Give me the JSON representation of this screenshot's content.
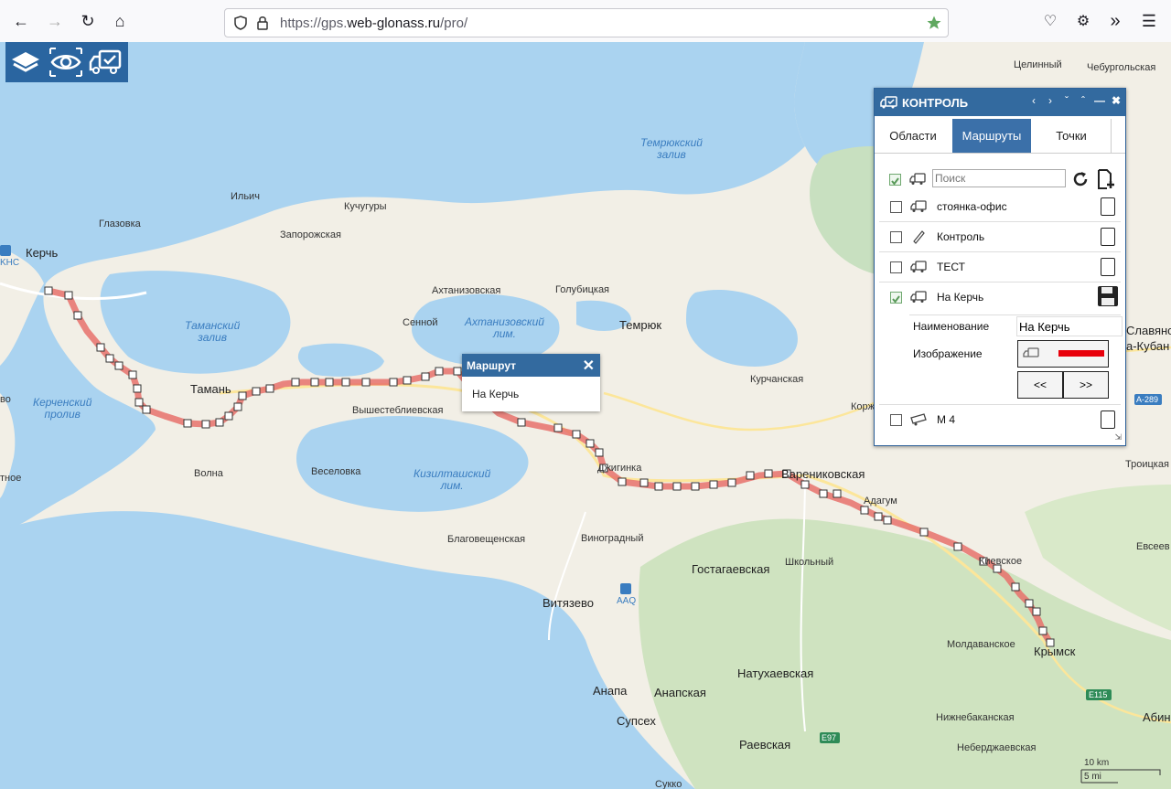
{
  "browser": {
    "url_prefix": "https://gps.",
    "url_domain": "web-glonass.ru",
    "url_path": "/pro/"
  },
  "map": {
    "labels": {
      "kerch": "Керчь",
      "khc": "KHC",
      "glazovka": "Глазовка",
      "ilich": "Ильич",
      "kuchuguri": "Кучугуры",
      "zaporozhskaya": "Запорожская",
      "taman": "Тамань",
      "volna": "Волна",
      "veselovka": "Веселовка",
      "vyshestebliyevskaya": "Вышестеблиевская",
      "akhtanizovskaya": "Ахтанизовская",
      "sennoy": "Сенной",
      "golubitskaya": "Голубицкая",
      "temryuk": "Темрюк",
      "kurchanskaya": "Курчанская",
      "blagoveshchenskaya": "Благовещенская",
      "vinogradniy": "Виноградный",
      "vityazevo": "Витязево",
      "aaq": "AAQ",
      "gostagaevskaya": "Гостагаевская",
      "shkolniy": "Школьный",
      "varenikovskaya": "Варениковская",
      "dzhiginka": "Джигинка",
      "adagum": "Адагум",
      "kievskoe": "Киевское",
      "krymsk": "Крымск",
      "moldavanskoe": "Молдаванское",
      "natukhaevskaya": "Натухаевская",
      "anapa": "Анапа",
      "anapskaya": "Анапская",
      "supseh": "Супсех",
      "raevskaya": "Раевская",
      "nizhnebakanskaya": "Нижнебаканская",
      "neberdzhaevskaya": "Неберджаевская",
      "tselinniy": "Целинный",
      "cheburgolskaya": "Чебургольская",
      "slavyansk": "Славянс",
      "kuban": "а-Кубан",
      "troitskaya": "Троицкая",
      "evseev": "Евсеев",
      "abin": "Абин",
      "korzh": "Корж",
      "sukko": "Сукко",
      "vo": "во",
      "tnoe": "тное",
      "temryuk_bay": "Темрюкский\nзалив",
      "taman_bay": "Таманский\nзалив",
      "kerch_strait": "Керченский\nпролив",
      "akhtanizovsky": "Ахтанизовский\nлим.",
      "kiziltashsky": "Кизилташский\nлим.",
      "road_a289": "А-289",
      "road_e115": "E115",
      "road_e97": "E97",
      "scale_km": "10 km",
      "scale_mi": "5 mi"
    },
    "colors": {
      "water": "#aad3f0",
      "land": "#f2efe6",
      "route": "#e8716b"
    }
  },
  "toolbar": {
    "icons": [
      "layers-icon",
      "eye-icon",
      "truck-check-icon"
    ]
  },
  "control_panel": {
    "title": "КОНТРОЛЬ",
    "tabs": [
      "Области",
      "Маршруты",
      "Точки"
    ],
    "active_tab": "Маршруты",
    "search_placeholder": "Поиск",
    "routes": [
      {
        "name": "стоянка-офис",
        "checked": false
      },
      {
        "name": "Контроль",
        "checked": false
      },
      {
        "name": "ТЕСТ",
        "checked": false
      },
      {
        "name": "На Керчь",
        "checked": true
      },
      {
        "name": "М 4",
        "checked": false
      }
    ],
    "details": {
      "name_label": "Наименование",
      "name_value": "На Керчь",
      "image_label": "Изображение",
      "prev_button": "<<",
      "next_button": ">>",
      "image_color": "#e8000b"
    }
  },
  "popup": {
    "title": "Маршрут",
    "content": "На Керчь"
  }
}
